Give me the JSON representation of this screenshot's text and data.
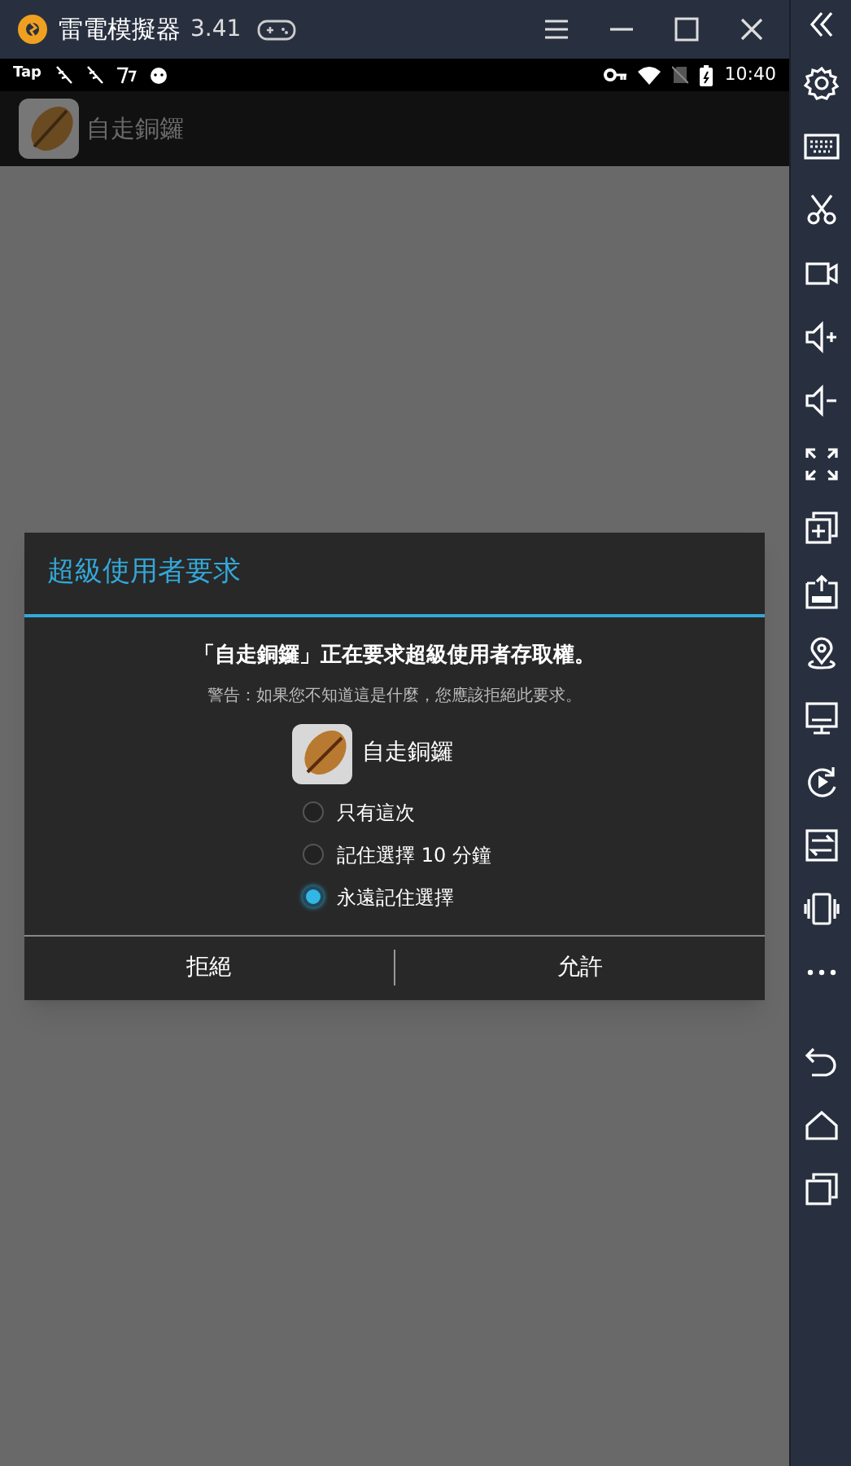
{
  "window": {
    "title": "雷電模擬器",
    "version": "3.41"
  },
  "status_bar": {
    "notification_label": "Tap",
    "time": "10:40"
  },
  "app_bar": {
    "title": "自走銅鑼"
  },
  "dialog": {
    "title": "超級使用者要求",
    "message": "「自走銅鑼」正在要求超級使用者存取權。",
    "warning": "警告：如果您不知道這是什麼，您應該拒絕此要求。",
    "app_name": "自走銅鑼",
    "options": [
      {
        "label": "只有這次",
        "selected": false
      },
      {
        "label": "記住選擇 10 分鐘",
        "selected": false
      },
      {
        "label": "永遠記住選擇",
        "selected": true
      }
    ],
    "buttons": [
      "拒絕",
      "允許"
    ]
  }
}
